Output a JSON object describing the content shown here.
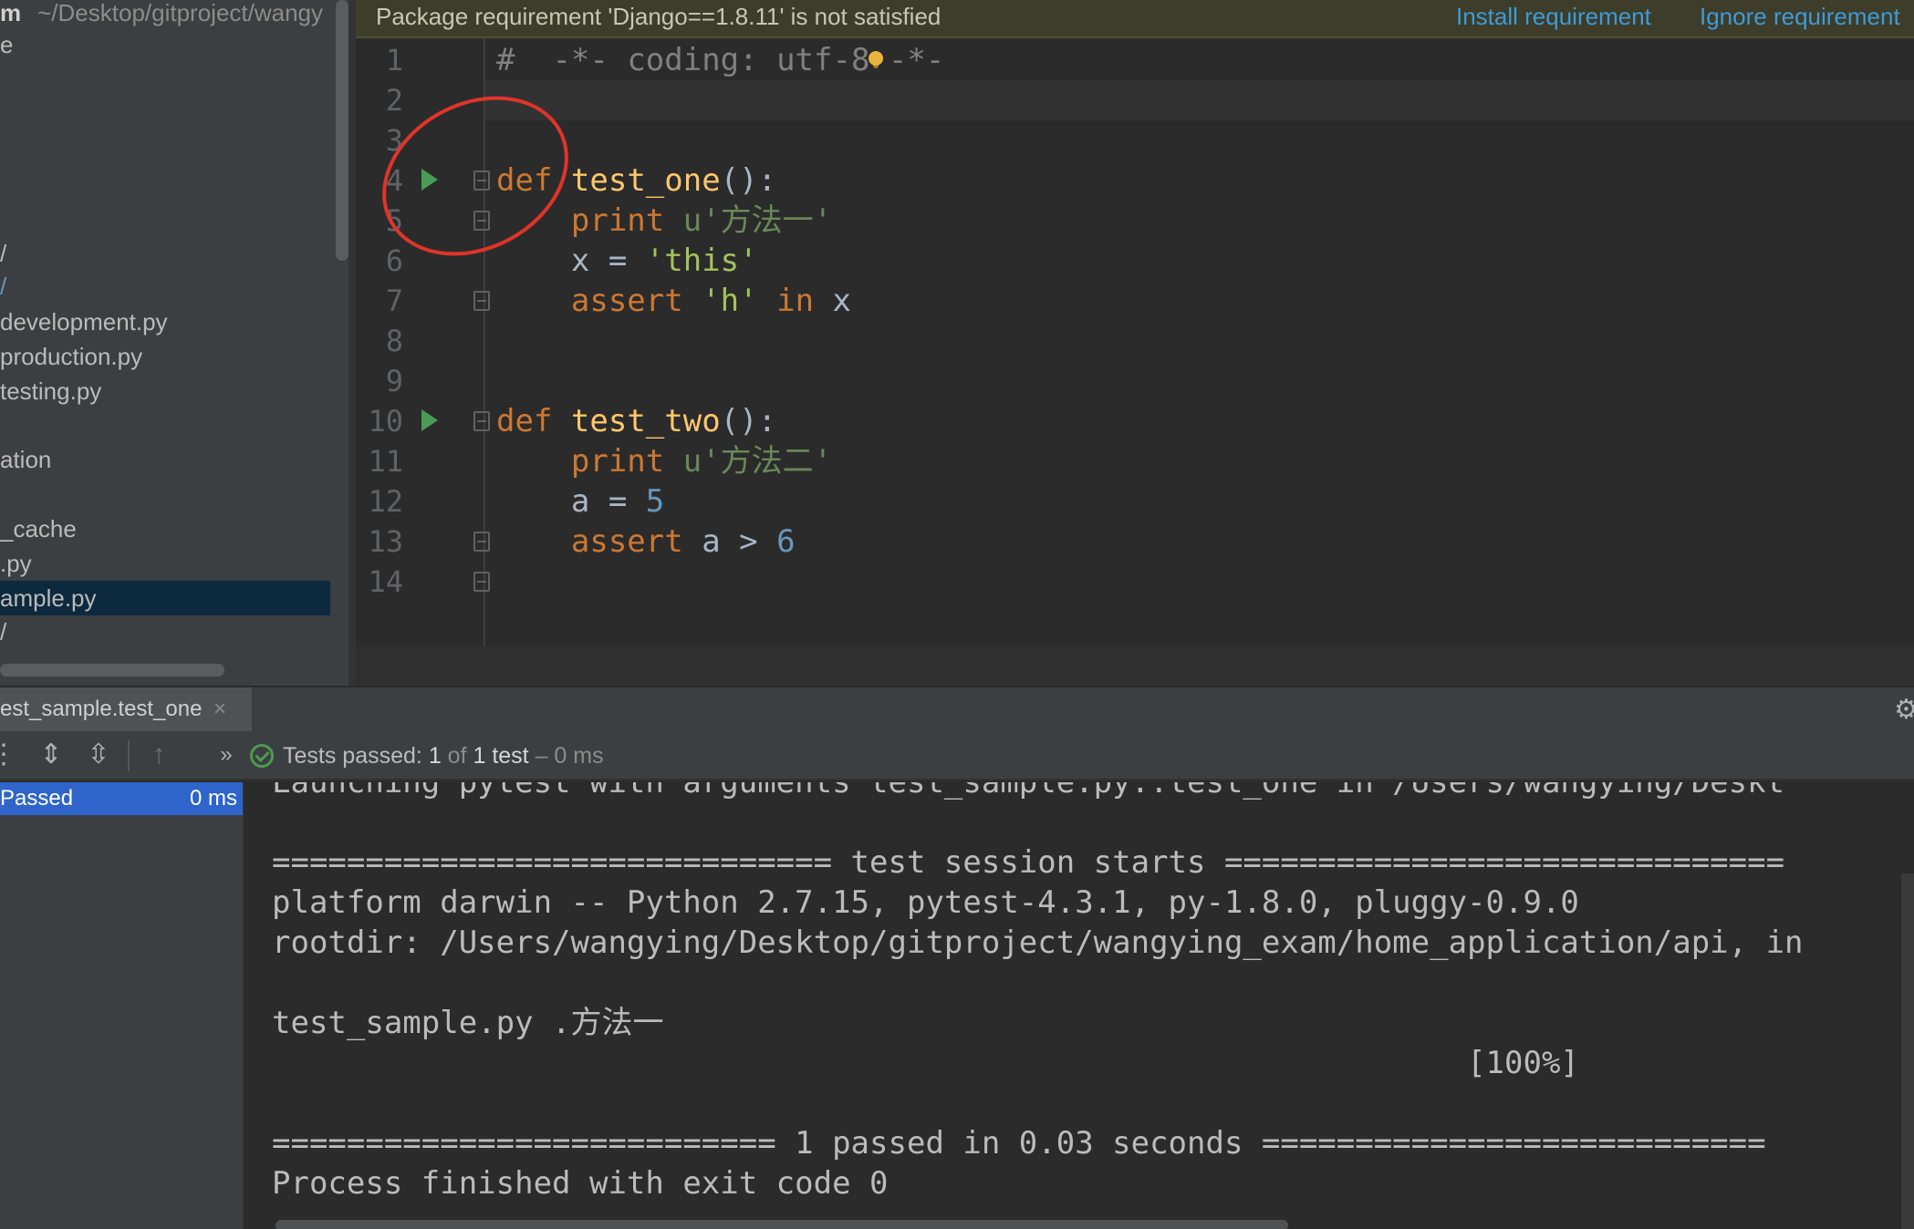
{
  "sidebar": {
    "header_bold": "m",
    "header_path": "~/Desktop/gitproject/wangy",
    "items": [
      {
        "label": "e"
      },
      {
        "label": "/"
      },
      {
        "label": "/"
      },
      {
        "label": "development.py"
      },
      {
        "label": "production.py"
      },
      {
        "label": "testing.py"
      },
      {
        "label": "ation"
      },
      {
        "label": "_cache"
      },
      {
        "label": ".py"
      },
      {
        "label": "ample.py"
      },
      {
        "label": "/"
      }
    ]
  },
  "banner": {
    "message": "Package requirement 'Django==1.8.11' is not satisfied",
    "install_label": "Install requirement",
    "ignore_label": "Ignore requirement"
  },
  "editor": {
    "line_numbers": [
      "1",
      "2",
      "3",
      "4",
      "5",
      "6",
      "7",
      "8",
      "9",
      "10",
      "11",
      "12",
      "13",
      "14"
    ],
    "code": {
      "l1_hash": "#",
      "l1_rest": "-*- coding: utf-8 -*-",
      "l4_kw": "def",
      "l4_fn": "test_one",
      "l4_rest": "():",
      "l5_kw": "print",
      "l5_str": "u'方法一'",
      "l6_var": "x = ",
      "l6_str": "'this'",
      "l7_kw": "assert",
      "l7_str": "'h'",
      "l7_in": "in",
      "l7_var": "x",
      "l10_kw": "def",
      "l10_fn": "test_two",
      "l10_rest": "():",
      "l11_kw": "print",
      "l11_str": "u'方法二'",
      "l12_var": "a = ",
      "l12_num": "5",
      "l13_kw": "assert",
      "l13_var": "a > ",
      "l13_num": "6"
    }
  },
  "run": {
    "tab_label": "est_sample.test_one",
    "tab_close": "×",
    "status_prefix": "Tests passed: ",
    "status_count": "1",
    "status_of": " of ",
    "status_total": "1 test",
    "status_time": " – 0 ms",
    "test_result": "Passed",
    "test_time": "0 ms",
    "console": [
      "Launching pytest with arguments test_sample.py::test_one in /Users/wangying/Deskt",
      "",
      "============================== test session starts ==============================",
      "platform darwin -- Python 2.7.15, pytest-4.3.1, py-1.8.0, pluggy-0.9.0",
      "rootdir: /Users/wangying/Desktop/gitproject/wangying_exam/home_application/api, in",
      "",
      "test_sample.py .方法一",
      "                                                                [100%]",
      "",
      "=========================== 1 passed in 0.03 seconds ===========================",
      "Process finished with exit code 0"
    ]
  }
}
